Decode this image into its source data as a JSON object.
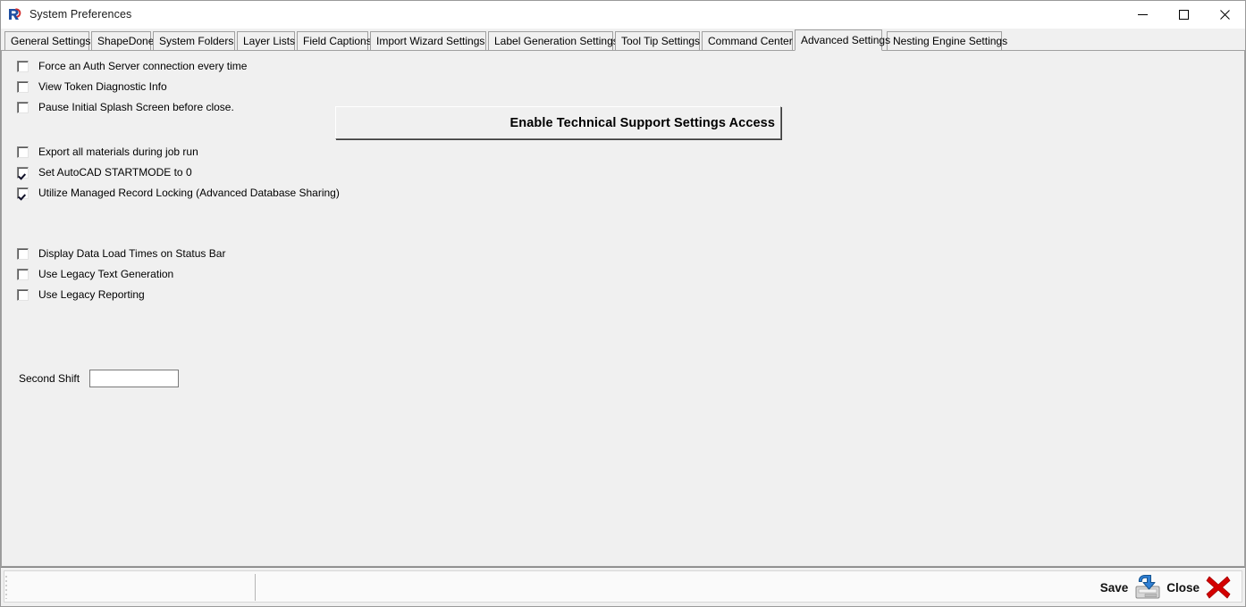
{
  "window": {
    "title": "System Preferences",
    "app_icon": "r-logo-icon",
    "controls": {
      "minimize": "minimize-icon",
      "maximize": "maximize-icon",
      "close": "close-icon"
    }
  },
  "tabs": [
    {
      "label": "General Settings",
      "active": false
    },
    {
      "label": "ShapeDone",
      "active": false
    },
    {
      "label": "System Folders",
      "active": false
    },
    {
      "label": "Layer Lists",
      "active": false
    },
    {
      "label": "Field Captions",
      "active": false
    },
    {
      "label": "Import Wizard Settings",
      "active": false
    },
    {
      "label": "Label Generation Settings",
      "active": false
    },
    {
      "label": "Tool Tip Settings",
      "active": false
    },
    {
      "label": "Command Center",
      "active": false
    },
    {
      "label": "Advanced Settings",
      "active": true
    },
    {
      "label": "Nesting Engine Settings",
      "active": false
    }
  ],
  "panel": {
    "tech_button_label": "Enable Technical Support Settings Access",
    "group_one": [
      {
        "label": "Force an Auth Server connection every time",
        "checked": false
      },
      {
        "label": "View Token Diagnostic Info",
        "checked": false
      },
      {
        "label": "Pause Initial Splash Screen before close.",
        "checked": false
      }
    ],
    "group_two": [
      {
        "label": "Export all materials during job run",
        "checked": false
      },
      {
        "label": "Set AutoCAD STARTMODE to 0",
        "checked": true
      },
      {
        "label": "Utilize Managed Record Locking (Advanced Database Sharing)",
        "checked": true
      }
    ],
    "group_three": [
      {
        "label": "Display Data Load Times on Status Bar",
        "checked": false
      },
      {
        "label": "Use Legacy Text Generation",
        "checked": false
      },
      {
        "label": "Use Legacy Reporting",
        "checked": false
      }
    ],
    "second_shift": {
      "label": "Second Shift",
      "value": "",
      "placeholder": ""
    }
  },
  "bottom_bar": {
    "status_left": "",
    "status_right": "",
    "save_label": "Save",
    "save_icon": "save-disk-icon",
    "close_label": "Close",
    "close_icon": "red-x-icon"
  },
  "colors": {
    "window_bg": "#f0f0f0",
    "titlebar_bg": "#ffffff",
    "border": "#a0a0a0",
    "accent_blue": "#1f5fbf",
    "close_red": "#cc0000",
    "text": "#000000"
  }
}
